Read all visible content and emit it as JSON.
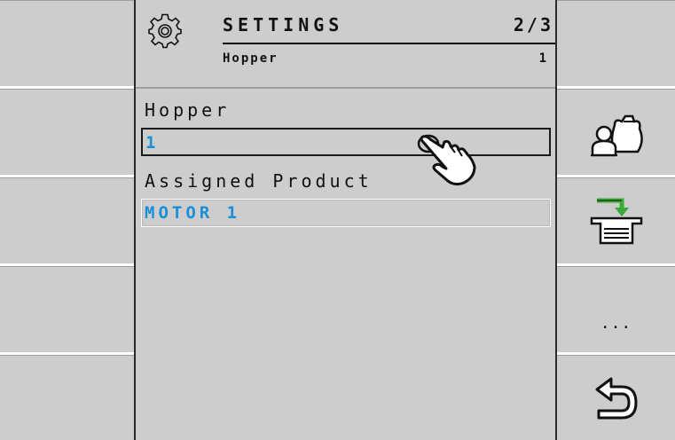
{
  "header": {
    "title": "SETTINGS",
    "page_indicator": "2/3",
    "subtitle": "Hopper",
    "subtitle_value": "1",
    "icon": "gear-icon"
  },
  "fields": {
    "hopper": {
      "label": "Hopper",
      "value": "1"
    },
    "assigned_product": {
      "label": "Assigned Product",
      "value": "MOTOR 1"
    }
  },
  "softkeys": {
    "right": [
      {
        "icon": "blank"
      },
      {
        "icon": "operator-product-bag-icon"
      },
      {
        "icon": "hopper-fill-arrow-icon"
      },
      {
        "icon": "more-dots-icon",
        "label": "..."
      },
      {
        "icon": "back-arrow-icon"
      }
    ]
  },
  "colors": {
    "panel": "#cdcdcd",
    "value_text": "#1a8fd6",
    "arrow_green": "#3aa935"
  }
}
